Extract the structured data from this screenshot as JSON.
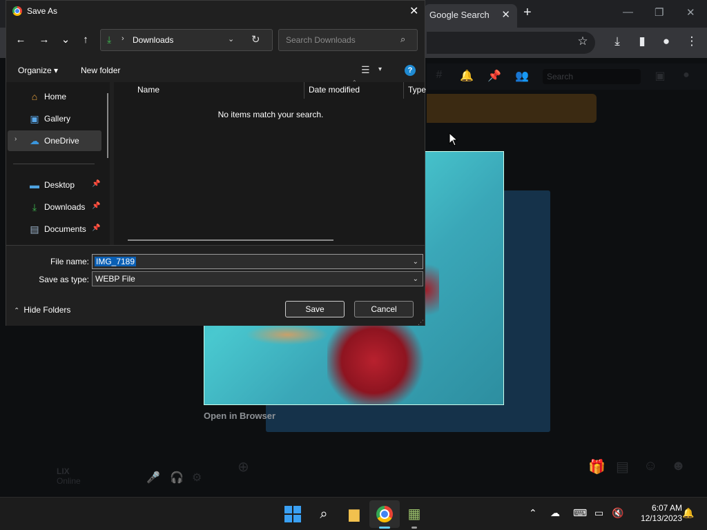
{
  "browser": {
    "tab_title": "Google Search",
    "tab_close": "✕",
    "new_tab": "+",
    "win_min": "—",
    "win_max": "❐",
    "win_close": "✕",
    "star_icon": "☆",
    "download_icon": "⤓",
    "sidepanel_icon": "▮",
    "profile_icon": "●",
    "menu_icon": "⋮"
  },
  "page": {
    "search_placeholder": "Search",
    "open_in_browser": "Open in Browser",
    "user_name": "LIX",
    "user_status": "Online"
  },
  "dialog": {
    "title": "Save As",
    "close": "✕",
    "nav": {
      "back": "←",
      "forward": "→",
      "recent": "⌄",
      "up": "↑"
    },
    "address": {
      "separator": "›",
      "path": "Downloads",
      "chevron": "⌄",
      "refresh": "↻"
    },
    "search": {
      "placeholder": "Search Downloads",
      "icon": "⌕"
    },
    "commands": {
      "organize": "Organize ▾",
      "new_folder": "New folder",
      "view": "☰",
      "view_dd": "▾",
      "help": "?"
    },
    "navpane": {
      "items": [
        {
          "label": "Home",
          "icon": "⌂"
        },
        {
          "label": "Gallery",
          "icon": "▣"
        },
        {
          "label": "OneDrive",
          "icon": "☁",
          "expand": "›"
        },
        {
          "label": "Desktop",
          "icon": "▬",
          "pin": "📌"
        },
        {
          "label": "Downloads",
          "icon": "⤓",
          "pin": "📌"
        },
        {
          "label": "Documents",
          "icon": "▤",
          "pin": "📌"
        }
      ]
    },
    "filelist": {
      "columns": [
        "Name",
        "Date modified",
        "Type"
      ],
      "sort_caret": "⌃",
      "empty_message": "No items match your search."
    },
    "form": {
      "filename_label": "File name:",
      "filename_value": "IMG_7189",
      "filetype_label": "Save as type:",
      "filetype_value": "WEBP File",
      "dropdown": "⌄",
      "save": "Save",
      "cancel": "Cancel",
      "hide_folders": "Hide Folders",
      "hide_caret": "⌃",
      "grip": "⋰"
    }
  },
  "taskbar": {
    "search_icon": "⌕",
    "explorer_icon": "▆",
    "app_icon": "▦",
    "tray_chevron": "⌃",
    "tray_onedrive": "☁",
    "tray_keyboard": "⌨",
    "tray_display": "▭",
    "tray_volume": "🔇",
    "time": "6:07 AM",
    "date": "12/13/2023",
    "notify_icon": "🔔"
  },
  "colors": {
    "accent": "#0a5fb4",
    "taskbar_active": "#60cdff",
    "onedrive": "#3a96dd",
    "downloads": "#3fb950"
  }
}
